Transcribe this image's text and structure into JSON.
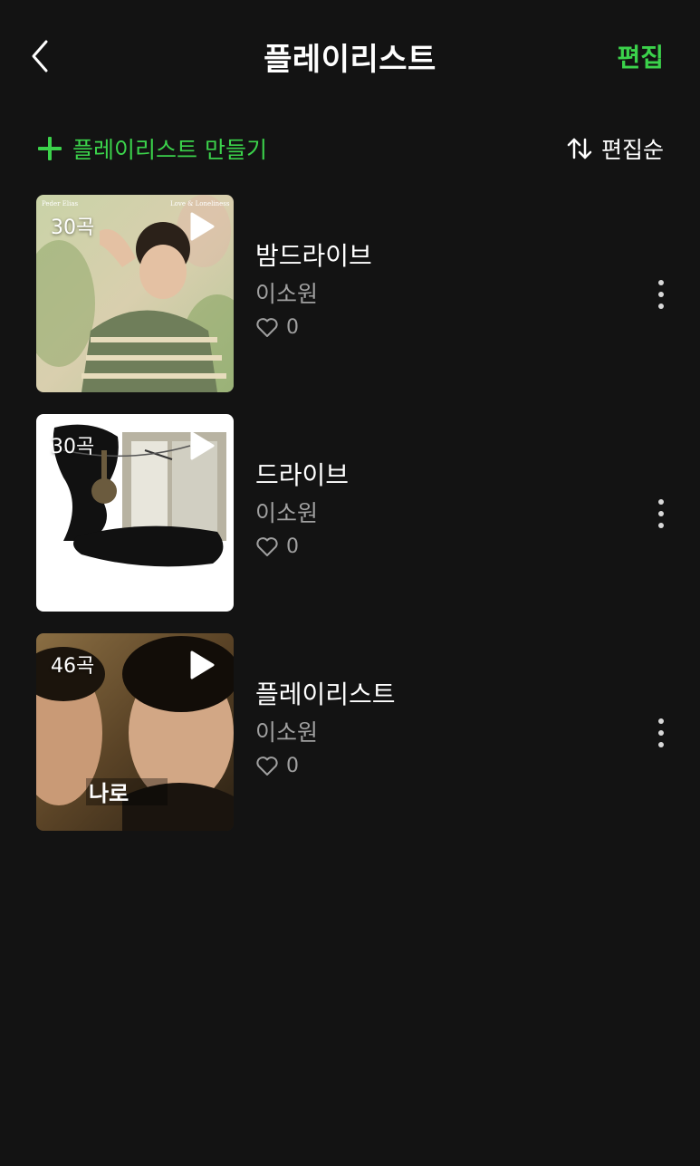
{
  "header": {
    "title": "플레이리스트",
    "edit_label": "편집",
    "back_icon": "chevron-left-icon"
  },
  "toolbar": {
    "create_label": "플레이리스트 만들기",
    "sort_label": "편집순",
    "accent_color": "#3bd24b"
  },
  "playlists": [
    {
      "title": "밤드라이브",
      "owner": "이소원",
      "count": "30곡",
      "likes": "0",
      "cover_text_left": "Peder Elias",
      "cover_text_right": "Love & Loneliness"
    },
    {
      "title": "드라이브",
      "owner": "이소원",
      "count": "30곡",
      "likes": "0"
    },
    {
      "title": "플레이리스트",
      "owner": "이소원",
      "count": "46곡",
      "likes": "0",
      "cover_text": "나로"
    }
  ]
}
